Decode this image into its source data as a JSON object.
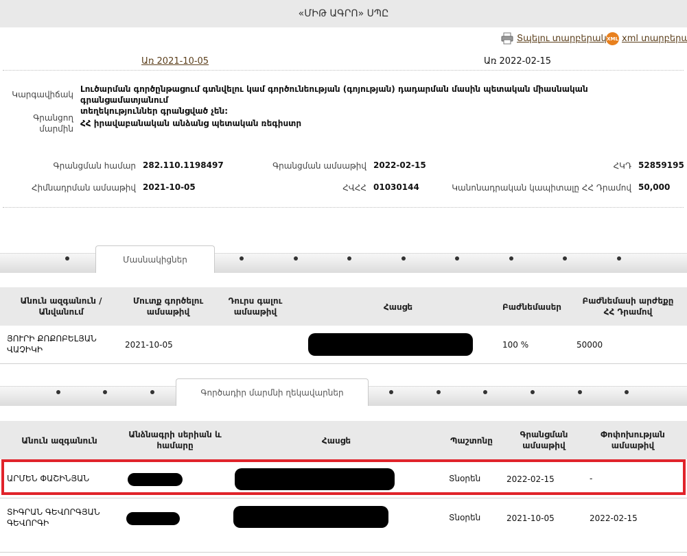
{
  "header": {
    "title": "«ՄԻԹ ԱԳՐՈ» ՍՊԸ"
  },
  "links": {
    "print": "Տպելու տարբերակ",
    "xml_badge": "XML",
    "xml": "xml տարբերակ"
  },
  "dates": {
    "from_link": "Առ 2021-10-05",
    "to_text": "Առ 2022-02-15"
  },
  "status": {
    "label": "Կարգավիճակ",
    "value_line1": "Լուծարման գործընթացում գտնվելու կամ գործունեության (գոյության) դադարման մասին պետական միասնական գրանցամատյանում",
    "value_line2": "տեղեկություններ գրանցված չեն:",
    "registry_label_1": "Գրանցող",
    "registry_label_2": "մարմին",
    "registry_value": "ՀՀ իրավաբանական անձանց պետական ռեգիստր"
  },
  "details": {
    "reg_number_label": "Գրանցման համար",
    "reg_number": "282.110.1198497",
    "reg_date_label": "Գրանցման ամսաթիվ",
    "reg_date": "2022-02-15",
    "tin_label": "ՀԿԴ",
    "tin": "52859195",
    "found_date_label": "Հիմնադրման ամսաթիվ",
    "found_date": "2021-10-05",
    "vat_label": "ՀՎՀՀ",
    "vat": "01030144",
    "capital_label": "Կանոնադրական կապիտալը ՀՀ Դրամով",
    "capital": "50,000"
  },
  "tabs1": {
    "active": "Մասնակիցներ"
  },
  "participants": {
    "headers": {
      "name_1": "Անուն ազգանուն /",
      "name_2": "Անվանում",
      "entry_1": "Մուտք գործելու",
      "entry_2": "ամսաթիվ",
      "exit_1": "Դուրս գալու",
      "exit_2": "ամսաթիվ",
      "address": "Հասցե",
      "share": "Բաժնեմասեր",
      "value_1": "Բաժնեմասի արժեքը",
      "value_2": "ՀՀ Դրամով"
    },
    "row": {
      "name_1": "ՅՈՒՐԻ ՔՈՔՈԲԵԼՅԱՆ",
      "name_2": "ՎԱՉԻԿԻ",
      "entry": "2021-10-05",
      "share": "100 %",
      "value": "50000"
    }
  },
  "tabs2": {
    "active": "Գործադիր մարմնի ղեկավարներ"
  },
  "managers": {
    "headers": {
      "name": "Անուն ազգանուն",
      "passport_1": "Անձնագրի սերիան և",
      "passport_2": "համարը",
      "address": "Հասցե",
      "position": "Պաշտոնը",
      "reg_1": "Գրանցման",
      "reg_2": "ամսաթիվ",
      "change_1": "Փոփոխության",
      "change_2": "ամսաթիվ"
    },
    "rows": [
      {
        "name_1": "ԱՐՄԵՆ ՓԱՇԻՆՅԱՆ",
        "name_2": "",
        "position": "Տնօրեն",
        "reg": "2022-02-15",
        "change": "-"
      },
      {
        "name_1": "ՏԻԳՐԱՆ ԳԵՎՈՐԳՅԱՆ",
        "name_2": "ԳԵՎՈՐԳԻ",
        "position": "Տնօրեն",
        "reg": "2021-10-05",
        "change": "2022-02-15"
      }
    ]
  }
}
